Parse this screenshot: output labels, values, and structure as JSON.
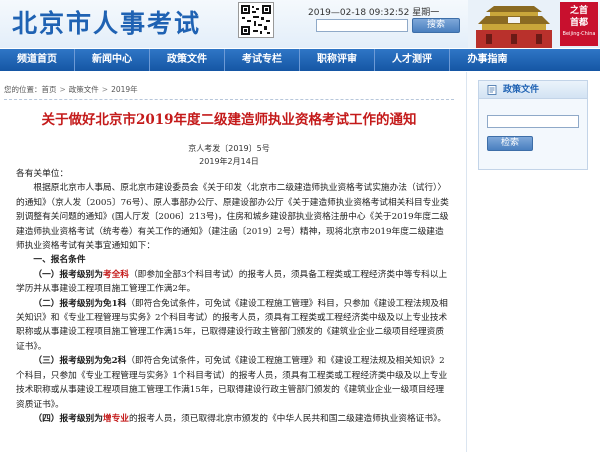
{
  "header": {
    "site_title": "北京市人事考试",
    "datetime": "2019—02-18 09:32:52 星期一",
    "search_placeholder": "",
    "search_button": "搜索",
    "logo_cn_line1": "之首",
    "logo_cn_line2": "首都",
    "logo_en": "Beijing·China"
  },
  "nav": {
    "items": [
      "频道首页",
      "新闻中心",
      "政策文件",
      "考试专栏",
      "职称评审",
      "人才测评",
      "办事指南"
    ]
  },
  "breadcrumb": {
    "prefix": "您的位置：",
    "items": [
      "首页",
      "政策文件",
      "2019年"
    ]
  },
  "article": {
    "title": "关于做好北京市2019年度二级建造师执业资格考试工作的通知",
    "doc_number": "京人考发〔2019〕5号",
    "date": "2019年2月14日",
    "salutation": "各有关单位：",
    "intro": "根据原北京市人事局、原北京市建设委员会《关于印发〈北京市二级建造师执业资格考试实施办法（试行）〉的通知》（京人发〔2005〕76号）、原人事部办公厅、原建设部办公厅《关于建造师执业资格考试相关科目专业类别调整有关问题的通知》(国人厅发〔2006〕213号)，住房和城乡建设部执业资格注册中心《关于2019年度二级建造师执业资格考试（统考卷）有关工作的通知》（建注函〔2019〕2号）精神，现将北京市2019年度二级建造师执业资格考试有关事宜通知如下：",
    "section1_heading": "一、报名条件",
    "c1_label": "（一）报考级别为",
    "c1_red": "考全科",
    "c1_text": "（即参加全部3个科目考试）的报考人员，须具备工程类或工程经济类中等专科以上学历并从事建设工程项目施工管理工作满2年。",
    "c2_label": "（二）报考级别为免1科",
    "c2_text": "（即符合免试条件，可免试《建设工程施工管理》科目，只参加《建设工程法规及相关知识》和《专业工程管理与实务》2个科目考试）的报考人员，须具有工程类或工程经济类中级及以上专业技术职称或从事建设工程项目施工管理工作满15年，已取得建设行政主管部门颁发的《建筑业企业二级项目经理资质证书》。",
    "c3_label": "（三）报考级别为免2科",
    "c3_text": "（即符合免试条件，可免试《建设工程施工管理》和《建设工程法规及相关知识》2个科目，只参加《专业工程管理与实务》1个科目考试）的报考人员，须具有工程类或工程经济类中级及以上专业技术职称或从事建设工程项目施工管理工作满15年，已取得建设行政主管部门颁发的《建筑业企业一级项目经理资质证书》。",
    "c4_label": "（四）报考级别为",
    "c4_red": "增专业",
    "c4_text": "的报考人员，须已取得北京市颁发的《中华人民共和国二级建造师执业资格证书》。"
  },
  "sidebar": {
    "title": "政策文件",
    "search_button": "检索"
  }
}
